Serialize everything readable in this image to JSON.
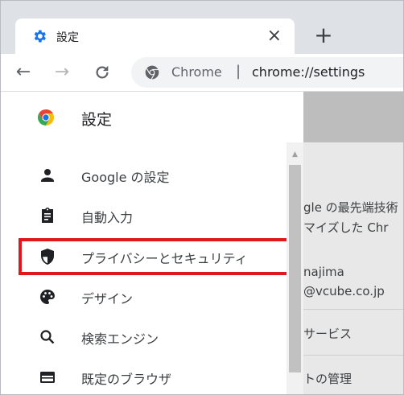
{
  "tab": {
    "title": "設定",
    "close": "×",
    "new_tab": "+"
  },
  "toolbar": {
    "back": "←",
    "forward": "→",
    "reload": "C",
    "site_name": "Chrome",
    "separator": "|",
    "url": "chrome://settings"
  },
  "settings": {
    "title": "設定"
  },
  "sidebar": {
    "items": [
      {
        "label": "Google の設定",
        "icon": "person-icon"
      },
      {
        "label": "自動入力",
        "icon": "clipboard-icon"
      },
      {
        "label": "プライバシーとセキュリティ",
        "icon": "shield-icon"
      },
      {
        "label": "デザイン",
        "icon": "palette-icon"
      },
      {
        "label": "検索エンジン",
        "icon": "search-icon"
      },
      {
        "label": "既定のブラウザ",
        "icon": "browser-window-icon"
      }
    ]
  },
  "content": {
    "line1": "gle の最先端技術",
    "line2": "マイズした Chr",
    "name": "najima",
    "email": "@vcube.co.jp",
    "services": "サービス",
    "manage": "トの管理"
  },
  "colors": {
    "accent_blue": "#1a73e8",
    "highlight_red": "#e0171d",
    "tabstrip_bg": "#dee1e6"
  }
}
